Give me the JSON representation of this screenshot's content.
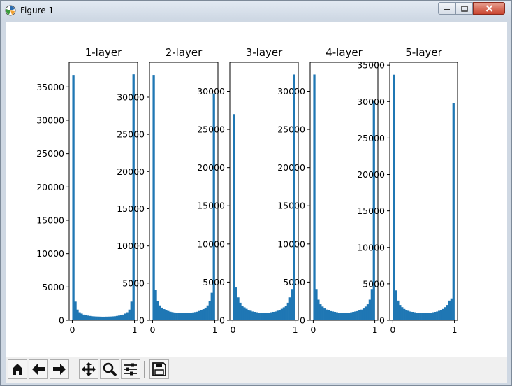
{
  "window": {
    "title": "Figure 1"
  },
  "icons": {
    "app": "matplotlib-icon",
    "minimize": "minimize-icon",
    "maximize": "maximize-icon",
    "close": "close-icon",
    "home": "home-icon",
    "back": "arrow-left-icon",
    "forward": "arrow-right-icon",
    "pan": "move-icon",
    "zoom": "magnifier-icon",
    "configure": "sliders-icon",
    "save": "floppy-disk-icon"
  },
  "colors": {
    "bar": "#1f77b4",
    "canvas": "#ffffff"
  },
  "chart_data": [
    {
      "type": "bar",
      "title": "1-layer",
      "x": [
        0.0167,
        0.05,
        0.0833,
        0.1167,
        0.15,
        0.1833,
        0.2167,
        0.25,
        0.2833,
        0.3167,
        0.35,
        0.3833,
        0.4167,
        0.45,
        0.4833,
        0.5167,
        0.55,
        0.5833,
        0.6167,
        0.65,
        0.6833,
        0.7167,
        0.75,
        0.7833,
        0.8167,
        0.85,
        0.8833,
        0.9167,
        0.95,
        0.9833
      ],
      "values": [
        36800,
        2800,
        1600,
        1200,
        1000,
        850,
        750,
        700,
        650,
        600,
        580,
        560,
        550,
        540,
        530,
        530,
        540,
        550,
        560,
        580,
        600,
        650,
        700,
        750,
        850,
        1000,
        1200,
        1600,
        2800,
        36900
      ],
      "xlim": [
        -0.05,
        1.05
      ],
      "ylim": [
        0,
        38700
      ],
      "xticks": [
        "0",
        "1"
      ],
      "yticks": [
        0,
        5000,
        10000,
        15000,
        20000,
        25000,
        30000,
        35000
      ]
    },
    {
      "type": "bar",
      "title": "2-layer",
      "x": [
        0.0167,
        0.05,
        0.0833,
        0.1167,
        0.15,
        0.1833,
        0.2167,
        0.25,
        0.2833,
        0.3167,
        0.35,
        0.3833,
        0.4167,
        0.45,
        0.4833,
        0.5167,
        0.55,
        0.5833,
        0.6167,
        0.65,
        0.6833,
        0.7167,
        0.75,
        0.7833,
        0.8167,
        0.85,
        0.8833,
        0.9167,
        0.95,
        0.9833
      ],
      "values": [
        33000,
        4100,
        2600,
        2000,
        1700,
        1500,
        1350,
        1250,
        1150,
        1100,
        1050,
        1000,
        1000,
        950,
        950,
        950,
        950,
        1000,
        1000,
        1050,
        1100,
        1150,
        1250,
        1350,
        1500,
        1700,
        2000,
        2600,
        3700,
        30500
      ],
      "xlim": [
        -0.05,
        1.05
      ],
      "ylim": [
        0,
        34700
      ],
      "xticks": [
        "0",
        "1"
      ],
      "yticks": [
        0,
        5000,
        10000,
        15000,
        20000,
        25000,
        30000
      ]
    },
    {
      "type": "bar",
      "title": "3-layer",
      "x": [
        0.0167,
        0.05,
        0.0833,
        0.1167,
        0.15,
        0.1833,
        0.2167,
        0.25,
        0.2833,
        0.3167,
        0.35,
        0.3833,
        0.4167,
        0.45,
        0.4833,
        0.5167,
        0.55,
        0.5833,
        0.6167,
        0.65,
        0.6833,
        0.7167,
        0.75,
        0.7833,
        0.8167,
        0.85,
        0.8833,
        0.9167,
        0.95,
        0.9833
      ],
      "values": [
        27000,
        4300,
        3000,
        2300,
        1900,
        1700,
        1500,
        1350,
        1250,
        1150,
        1100,
        1050,
        1000,
        1000,
        980,
        980,
        1000,
        1000,
        1050,
        1100,
        1150,
        1250,
        1350,
        1500,
        1700,
        1900,
        2300,
        3000,
        4100,
        32200
      ],
      "xlim": [
        -0.05,
        1.05
      ],
      "ylim": [
        0,
        33800
      ],
      "xticks": [
        "0",
        "1"
      ],
      "yticks": [
        0,
        5000,
        10000,
        15000,
        20000,
        25000,
        30000
      ]
    },
    {
      "type": "bar",
      "title": "4-layer",
      "x": [
        0.0167,
        0.05,
        0.0833,
        0.1167,
        0.15,
        0.1833,
        0.2167,
        0.25,
        0.2833,
        0.3167,
        0.35,
        0.3833,
        0.4167,
        0.45,
        0.4833,
        0.5167,
        0.55,
        0.5833,
        0.6167,
        0.65,
        0.6833,
        0.7167,
        0.75,
        0.7833,
        0.8167,
        0.85,
        0.8833,
        0.9167,
        0.95,
        0.9833
      ],
      "values": [
        32200,
        4100,
        2700,
        2100,
        1800,
        1550,
        1400,
        1300,
        1200,
        1150,
        1100,
        1050,
        1000,
        1000,
        980,
        980,
        1000,
        1000,
        1050,
        1100,
        1150,
        1200,
        1300,
        1400,
        1550,
        1800,
        2100,
        2700,
        4100,
        28800
      ],
      "xlim": [
        -0.05,
        1.05
      ],
      "ylim": [
        0,
        33800
      ],
      "xticks": [
        "0",
        "1"
      ],
      "yticks": [
        0,
        5000,
        10000,
        15000,
        20000,
        25000,
        30000
      ]
    },
    {
      "type": "bar",
      "title": "5-layer",
      "x": [
        0.0167,
        0.05,
        0.0833,
        0.1167,
        0.15,
        0.1833,
        0.2167,
        0.25,
        0.2833,
        0.3167,
        0.35,
        0.3833,
        0.4167,
        0.45,
        0.4833,
        0.5167,
        0.55,
        0.5833,
        0.6167,
        0.65,
        0.6833,
        0.7167,
        0.75,
        0.7833,
        0.8167,
        0.85,
        0.8833,
        0.9167,
        0.95,
        0.9833
      ],
      "values": [
        33700,
        4100,
        2700,
        2100,
        1800,
        1550,
        1400,
        1300,
        1200,
        1150,
        1100,
        1050,
        1000,
        1000,
        980,
        980,
        1000,
        1000,
        1050,
        1100,
        1150,
        1200,
        1300,
        1400,
        1550,
        1800,
        2100,
        2700,
        3000,
        29800
      ],
      "xlim": [
        -0.05,
        1.05
      ],
      "ylim": [
        0,
        35400
      ],
      "xticks": [
        "0",
        "1"
      ],
      "yticks": [
        0,
        5000,
        10000,
        15000,
        20000,
        25000,
        30000,
        35000
      ]
    }
  ]
}
